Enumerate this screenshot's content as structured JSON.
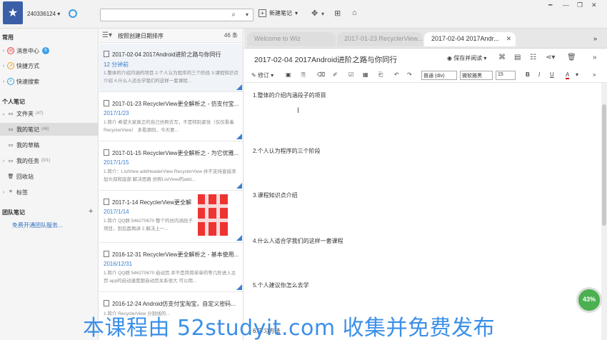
{
  "topbar": {
    "account": "240336124",
    "account_arrow": "▾",
    "search_placeholder": "",
    "new_note_label": "新建笔记",
    "window": {
      "pin": "━",
      "minimize": "—",
      "restore": "❐",
      "close": "✕"
    }
  },
  "sidebar": {
    "section_common": "常用",
    "items_common": [
      {
        "label": "消息中心",
        "badge": "6"
      },
      {
        "label": "快捷方式"
      },
      {
        "label": "快速搜索"
      }
    ],
    "section_personal": "个人笔记",
    "folder_root": {
      "label": "文件夹",
      "count": "(47)"
    },
    "folders": [
      {
        "label": "我的笔记",
        "count": "(46)"
      },
      {
        "label": "我的草稿"
      },
      {
        "label": "我的任务",
        "count": "(0/1)"
      },
      {
        "label": "回收站"
      }
    ],
    "tags_label": "标签",
    "section_team": "团队笔记",
    "team_plus": "+",
    "team_link": "免费开通团队服务..."
  },
  "notelist": {
    "sort_label": "按照创建日期排序",
    "count": "46 条",
    "notes": [
      {
        "title": "2017-02-04 2017Android进阶之路与你同行",
        "date": "12 分钟前",
        "summary": "1.整体的介绍内涵的项目 2.个人认为程序的三个阶段 3.课程知识点介绍 4.什么人适合学我们的这样一套课程..."
      },
      {
        "title": "2017-01-23 RecyclerView更全解析之 - 仿支付宝...",
        "date": "2017/1/23",
        "summary": "1.简介   希望大家真正的自己仿照去写，不是特别紧张（仅仅看着RecyclerView）   多看源码，今天要..."
      },
      {
        "title": "2017-01-15 RecyclerView更全解析之 - 为它优雅...",
        "date": "2017/1/15",
        "summary": "1.简介：ListView addHeaderView RecyclerView 并不支持直接添加头部和底部 解决思路 仿照ListView的add..."
      },
      {
        "title": "2017-1-14 RecyclerView更全解...",
        "date": "2017/1/14",
        "summary": "1.简介 QQ群 546270670 整个的仿内涵段子项目，到后面再讲 2.解决上一..."
      },
      {
        "title": "2016-12-31 RecyclerView更全解析之 - 基本使用...",
        "date": "2016/12/31",
        "summary": "1.简介 QQ群 546270670 启动页 并不是简简单单的等几秒进入主页 app的启动速度跟启动页关系很大 可以用..."
      },
      {
        "title": "2016-12-24 Android仿支付宝淘宝，自定义密码...",
        "date": "",
        "summary": "1.简介 RecyclerView 分割线的..."
      }
    ]
  },
  "editor": {
    "tabs": [
      {
        "label": "Welcome to Wiz"
      },
      {
        "label": "2017-01-23 RecyclerView..."
      },
      {
        "label": "2017-02-04 2017Andr...",
        "close": "✕"
      }
    ],
    "more": "»",
    "title": "2017-02-04 2017Android进阶之路与你同行",
    "save_label": "保存并阅读",
    "fmt": {
      "revise": "修订",
      "style": "普通 (div)",
      "font": "微软雅黑",
      "size": "15",
      "bold": "B",
      "italic": "I",
      "underline": "U",
      "color": "A"
    },
    "paragraphs": [
      "1.整体的介绍内涵段子的项目",
      "2.个人认为程序的三个阶段",
      "3.课程知识点介绍",
      "4.什么人适合学我们的这样一套课程",
      "5.个人建议你怎么去学",
      "6.学习方法"
    ]
  },
  "progress": "43%",
  "watermark": "本课程由 52studyit.com 收集并免费发布",
  "colors": {
    "accent": "#3a7fd0",
    "logo": "#3a5fa8",
    "progress": "#4caf50",
    "watermark": "#3b8fe8"
  }
}
